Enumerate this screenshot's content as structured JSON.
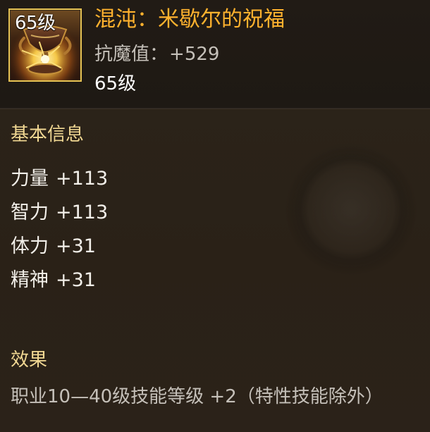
{
  "item": {
    "title": "混沌：米歇尔的祝福",
    "icon_level": "65级",
    "stat_name": "抗魔值",
    "stat_sep": "：",
    "stat_value": "+529",
    "level_text": "65级",
    "icon": "golden-chalice-icon"
  },
  "basic_info": {
    "title": "基本信息",
    "attributes": [
      {
        "name": "力量",
        "value": "+113"
      },
      {
        "name": "智力",
        "value": "+113"
      },
      {
        "name": "体力",
        "value": "+31"
      },
      {
        "name": "精神",
        "value": "+31"
      }
    ]
  },
  "effect": {
    "title": "效果",
    "text": "职业10—40级技能等级 +2（特性技能除外）"
  },
  "colors": {
    "title": "#ffb22e",
    "section_title": "#f1d893",
    "icon_border": "#e5c153"
  }
}
